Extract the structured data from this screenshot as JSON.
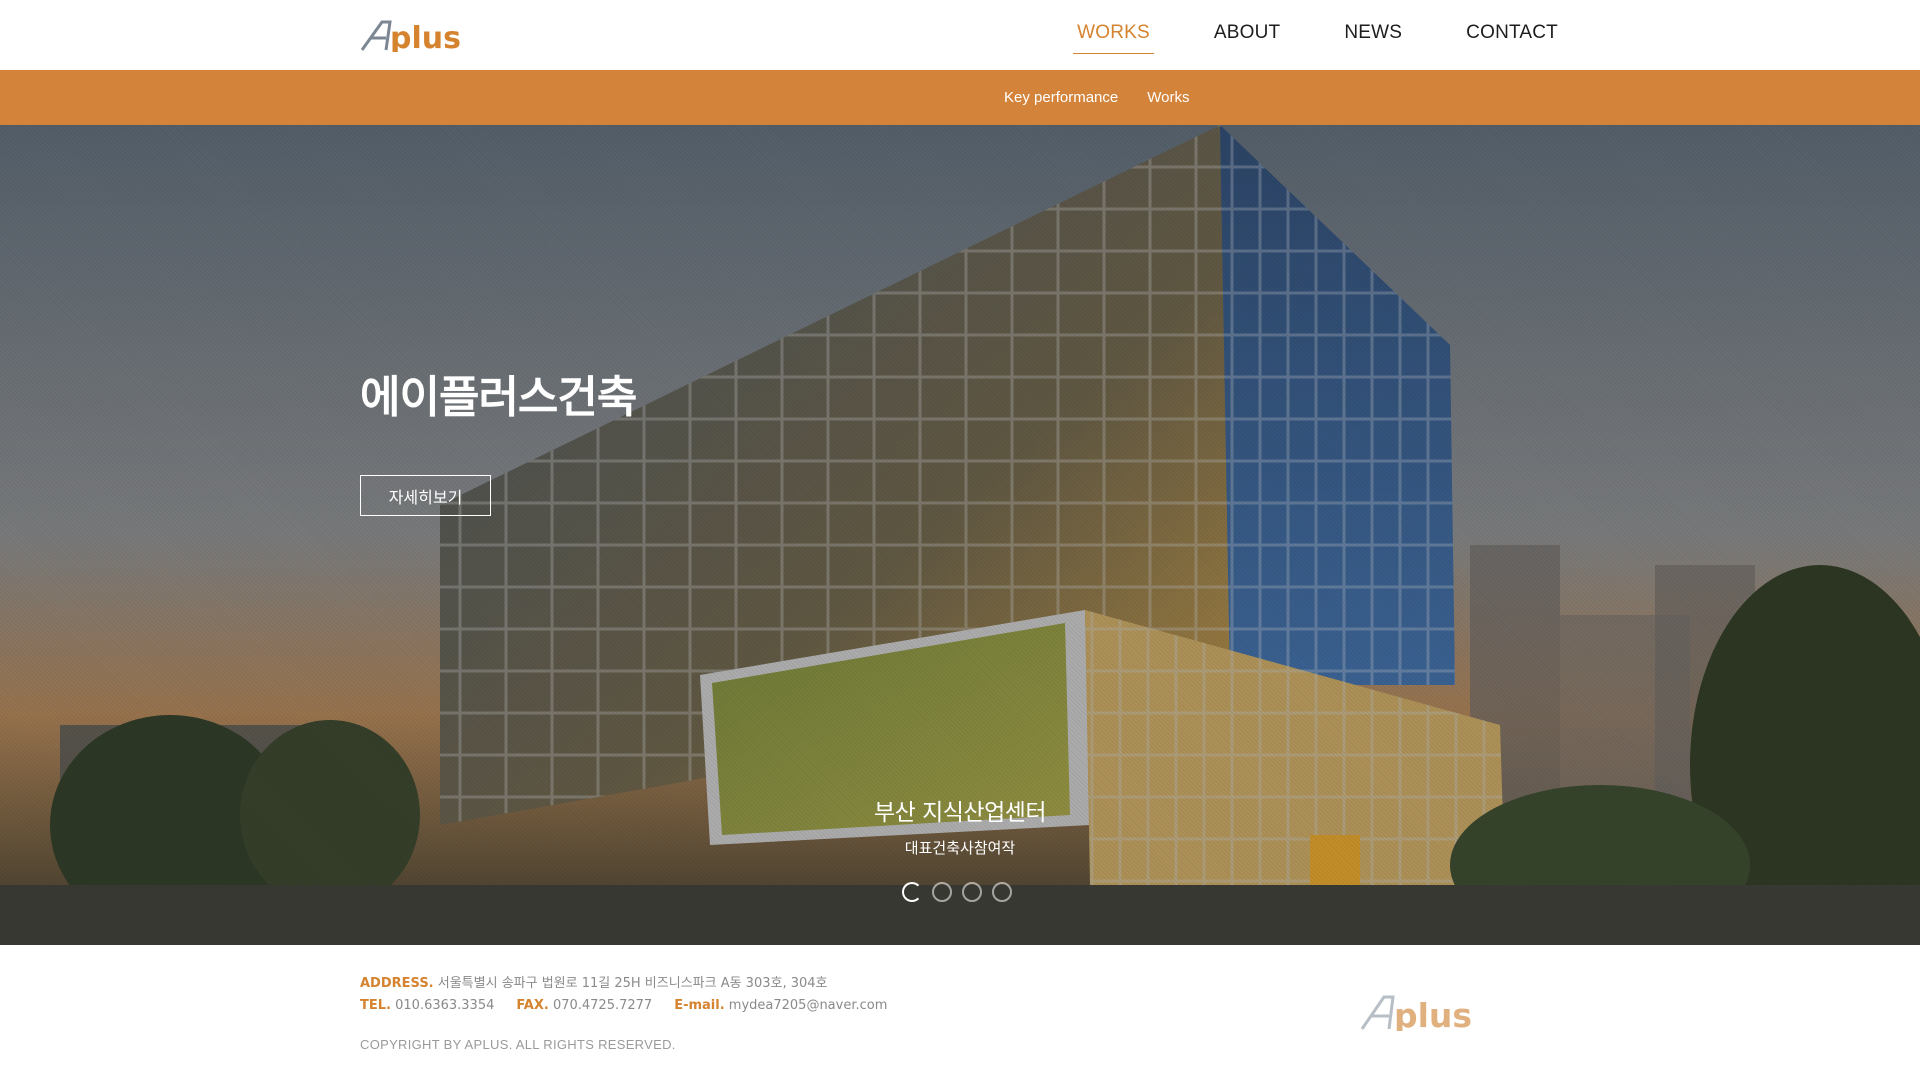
{
  "header": {
    "logo_text": "Aplus",
    "nav": [
      {
        "label": "WORKS",
        "active": true
      },
      {
        "label": "ABOUT",
        "active": false
      },
      {
        "label": "NEWS",
        "active": false
      },
      {
        "label": "CONTACT",
        "active": false
      }
    ]
  },
  "subnav": {
    "items": [
      "Key performance",
      "Works"
    ]
  },
  "hero": {
    "title": "에이플러스건축",
    "button_label": "자세히보기",
    "slide_title": "부산 지식산업센터",
    "slide_subtitle": "대표건축사참여작",
    "slide_count": 4,
    "active_slide": 1
  },
  "footer": {
    "address_label": "ADDRESS.",
    "address": "서울특별시 송파구 법원로 11길 25H 비즈니스파크 A동 303호, 304호",
    "tel_label": "TEL.",
    "tel": "010.6363.3354",
    "fax_label": "FAX.",
    "fax": "070.4725.7277",
    "email_label": "E-mail.",
    "email": "mydea7205@naver.com",
    "copyright": "COPYRIGHT BY APLUS. ALL RIGHTS RESERVED.",
    "logo_text": "Aplus"
  },
  "colors": {
    "accent": "#d5832f",
    "subnav_bg": "#d4833a",
    "text_dark": "#1d1d1d"
  }
}
